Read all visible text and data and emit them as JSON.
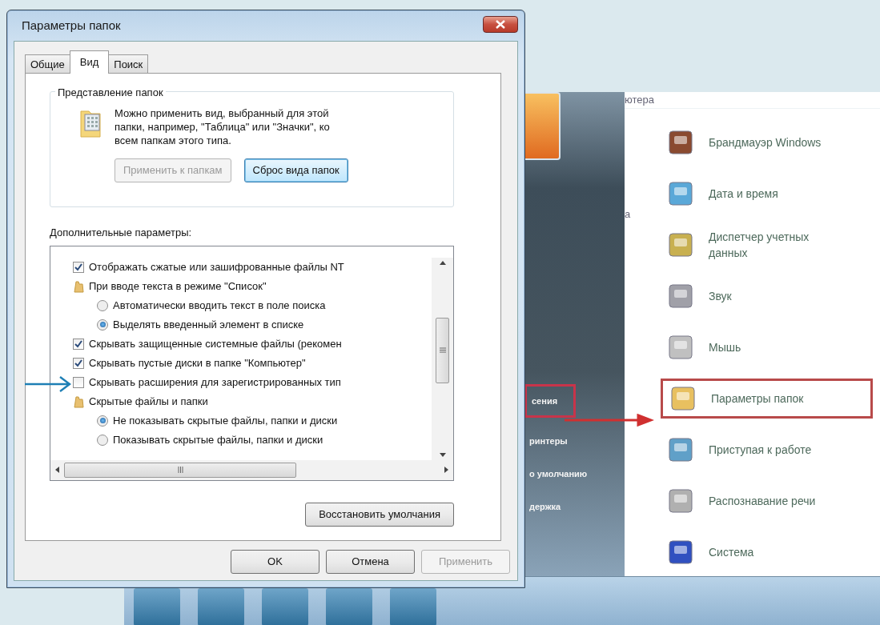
{
  "dialog": {
    "title": "Параметры папок",
    "tabs": [
      {
        "label": "Общие",
        "selected": false
      },
      {
        "label": "Вид",
        "selected": true
      },
      {
        "label": "Поиск",
        "selected": false
      }
    ],
    "folder_views": {
      "legend": "Представление папок",
      "description": "Можно применить вид, выбранный для этой папки, например, \"Таблица\" или \"Значки\", ко всем папкам этого типа.",
      "buttons": [
        {
          "label": "Применить к папкам",
          "disabled": true,
          "focused": false
        },
        {
          "label": "Сброс вида папок",
          "disabled": false,
          "focused": true
        }
      ]
    },
    "advanced": {
      "label": "Дополнительные параметры:",
      "items": [
        {
          "kind": "checkbox",
          "text": "Отображать сжатые или зашифрованные файлы NT",
          "checked": true,
          "pointed": false
        },
        {
          "kind": "folder",
          "text": "При вводе текста в режиме \"Список\"",
          "children": [
            {
              "kind": "radio",
              "text": "Автоматически вводить текст в поле поиска",
              "selected": false
            },
            {
              "kind": "radio",
              "text": "Выделять введенный элемент в списке",
              "selected": true
            }
          ]
        },
        {
          "kind": "checkbox",
          "text": "Скрывать защищенные системные файлы (рекомен",
          "checked": true,
          "pointed": false
        },
        {
          "kind": "checkbox",
          "text": "Скрывать пустые диски в папке \"Компьютер\"",
          "checked": true,
          "pointed": false
        },
        {
          "kind": "checkbox",
          "text": "Скрывать расширения для зарегистрированных тип",
          "checked": false,
          "pointed": true
        },
        {
          "kind": "folder",
          "text": "Скрытые файлы и папки",
          "children": [
            {
              "kind": "radio",
              "text": "Не показывать скрытые файлы, папки и диски",
              "selected": true
            },
            {
              "kind": "radio",
              "text": "Показывать скрытые файлы, папки и диски",
              "selected": false
            }
          ]
        }
      ],
      "restore_button": "Восстановить умолчания"
    },
    "buttons": [
      {
        "label": "OK",
        "disabled": false
      },
      {
        "label": "Отмена",
        "disabled": false
      },
      {
        "label": "Применить",
        "disabled": true
      }
    ]
  },
  "control_panel": {
    "header": "ютера",
    "column_text": "а",
    "sidebar": [
      {
        "text": "сения",
        "highlighted": true
      },
      {
        "text": "ринтеры",
        "highlighted": false
      },
      {
        "text": "о умолчанию",
        "highlighted": false
      },
      {
        "text": "держка",
        "highlighted": false
      }
    ],
    "items": [
      {
        "text": "Брандмауэр Windows",
        "highlighted": false
      },
      {
        "text": "Дата и время",
        "highlighted": false
      },
      {
        "text": "Диспетчер учетных данных",
        "highlighted": false
      },
      {
        "text": "Звук",
        "highlighted": false
      },
      {
        "text": "Мышь",
        "highlighted": false
      },
      {
        "text": "Параметры папок",
        "highlighted": true
      },
      {
        "text": "Приступая к работе",
        "highlighted": false
      },
      {
        "text": "Распознавание речи",
        "highlighted": false
      },
      {
        "text": "Система",
        "highlighted": false
      }
    ]
  }
}
